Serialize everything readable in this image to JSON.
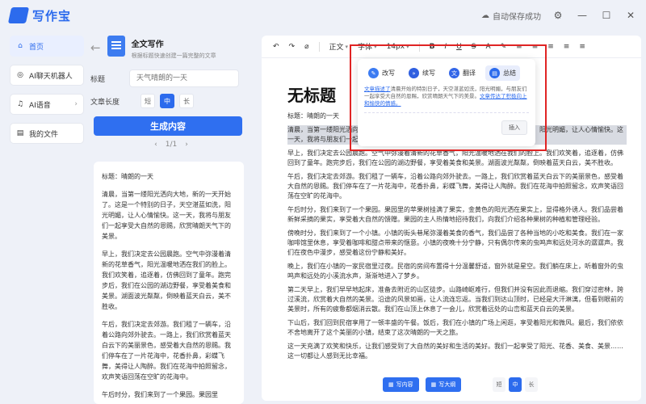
{
  "app": {
    "name": "写作宝",
    "autosave": "自动保存成功"
  },
  "sidebar": {
    "items": [
      {
        "label": "首页",
        "active": true
      },
      {
        "label": "AI聊天机器人"
      },
      {
        "label": "AI语音",
        "chevron": "›"
      },
      {
        "label": "我的文件"
      }
    ]
  },
  "mid": {
    "title": "全文写作",
    "subtitle": "根据标题快速创建一篇完整的文章",
    "title_label": "标题",
    "title_placeholder": "天气晴朗的一天",
    "length_label": "文章长度",
    "length_options": [
      "短",
      "中",
      "长"
    ],
    "length_selected": "中",
    "generate_label": "生成内容",
    "pager": "1/1",
    "result": [
      "标题：晴朗的一天",
      "清晨，当第一缕阳光洒向大地，新的一天开始了。这是一个特别的日子，天空湛蓝如洗，阳光明媚，让人心情愉快。这一天，我将与朋友们一起享受大自然的恩赐，欣赏晴朗天气下的美景。",
      "早上，我们决定去公园晨跑。空气中弥漫着清新的花草香气，阳光温暖地洒在我们的脸上。我们欢笑着，追逐着，仿佛回到了童年。跑完步后，我们在公园的湖边野餐，享受着美食和美景。湖面波光粼粼，倒映着蓝天白云，美不胜收。",
      "午后，我们决定去郊游。我们租了一辆车，沿着公路向郊外驶去。一路上，我们欣赏着蓝天白云下的美丽景色，感受着大自然的恩赐。我们停车在了一片花海中，花香扑鼻，彩蝶飞舞，美得让人陶醉。我们在花海中拍照留念，欢声笑语回荡在空旷的花海中。",
      "午后时分，我们来到了一个果园。果园里"
    ]
  },
  "toolbar": {
    "items": [
      "↶",
      "↷",
      "⌀",
      "正文",
      "字体",
      "14px",
      "B",
      "I",
      "U",
      "S",
      "A",
      "✎"
    ],
    "more": [
      "≡",
      "≡",
      "≡",
      "≡",
      "≡"
    ]
  },
  "doc": {
    "title": "无标题",
    "paragraphs": [
      "标题：晴朗的一天",
      "清晨，当第一缕阳光洒向大地，新的一天开始了。这是一个特别的日子，天空湛蓝如洗，阳光明媚，让人心情愉快。这一天，我将与朋友们一起享受大自然的恩赐，欣赏晴朗天气下的美景。",
      "早上，我们决定去公园晨跑。空气中弥漫着清新的花草香气，阳光温暖地洒在我们的脸上。我们欢笑着，追逐着，仿佛回到了童年。跑完步后，我们在公园的湖边野餐，享受着美食和美景。湖面波光粼粼，倒映着蓝天白云，美不胜收。",
      "午后，我们决定去郊游。我们租了一辆车，沿着公路向郊外驶去。一路上，我们欣赏着蓝天白云下的美丽景色，感受着大自然的恩赐。我们停车在了一片花海中，花香扑鼻，彩蝶飞舞，美得让人陶醉。我们在花海中拍照留念，欢声笑语回荡在空旷的花海中。",
      "午后时分，我们来到了一个果园。果园里的苹果树挂满了果实，金黄色的阳光洒在果实上，显得格外诱人。我们品尝着新鲜采摘的果实，享受着大自然的馈赠。果园的主人热情地招待我们，向我们介绍各种果树的种植和管理经验。",
      "傍晚时分，我们来到了一个小镇。小镇的街头巷尾弥漫着美食的香气，我们品尝了各种当地的小吃和美食。我们在一家咖啡馆里休息，享受着咖啡和甜点带来的惬意。小镇的夜晚十分宁静，只有偶尔传来的虫鸣声和远处河水的潺潺声。我们在夜色中漫步，感受着这份宁静和美好。",
      "晚上，我们在小镇的一家民宿里过夜。民宿的房间布置得十分温馨舒适，窗外就是星空。我们躺在床上，听着窗外的虫鸣声和远处的小溪流水声，渐渐地进入了梦乡。",
      "第二天早上，我们早早地起床，准备去附近的山区徒步。山路崎岖难行，但我们并没有因此而退缩。我们穿过密林，跨过溪流，欣赏着大自然的美景。沿途的风景如画，让人流连忘返。当我们到达山顶时，已经是大汗淋漓，但看到眼前的美景时，所有的疲惫都烟消云散。我们在山顶上休息了一会儿，欣赏着远处的山峦和蓝天白云的美景。",
      "下山后，我们回到民宿享用了一顿丰盛的午餐。饭后，我们在小镇的广场上闲逛，享受着阳光和微风。最后，我们依依不舍地离开了这个美丽的小镇，结束了这次晴朗的一天之旅。",
      "这一天充满了欢笑和快乐，让我们感受到了大自然的美好和生活的美好。我们一起享受了阳光、花香、美食、美景……这一切都让人感到无比幸福。"
    ]
  },
  "popup": {
    "actions": [
      {
        "label": "改写",
        "color": "#3b7bf2"
      },
      {
        "label": "续写",
        "color": "#2f5fe0"
      },
      {
        "label": "翻译",
        "color": "#3366e8"
      },
      {
        "label": "总结",
        "color": "#2c6bed",
        "active": true
      }
    ],
    "summary_link1": "文章描述了",
    "summary_body": "清晨开始的特别日子，天空湛蓝如洗，阳光明媚，与朋友们一起享受大自然的恩赐，欣赏晴朗天气下的美景。",
    "summary_link2": "文章传达了积极向上和愉快的情感。",
    "insert_label": "插入"
  },
  "bottom": {
    "write_label": "写内容",
    "outline_label": "写大纲",
    "length_options": [
      "短",
      "中",
      "长"
    ],
    "length_selected": "中"
  }
}
